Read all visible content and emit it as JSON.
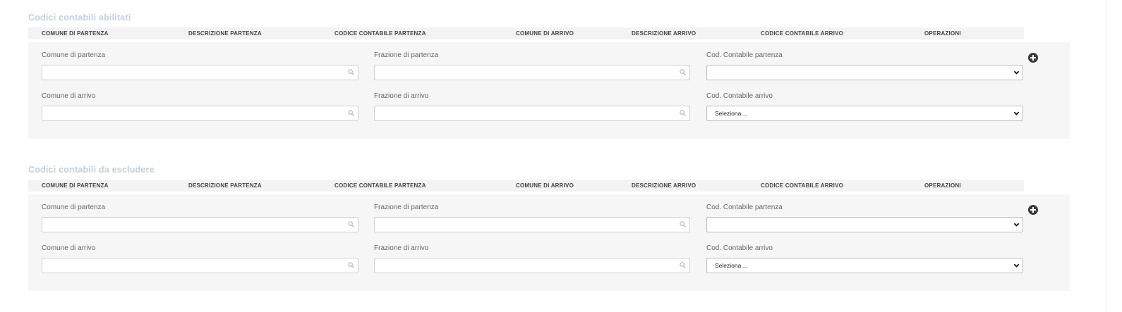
{
  "sections": [
    {
      "title": "Codici contabili abilitati",
      "columns": [
        "COMUNE DI PARTENZA",
        "DESCRIZIONE PARTENZA",
        "CODICE CONTABILE PARTENZA",
        "COMUNE DI ARRIVO",
        "DESCRIZIONE ARRIVO",
        "CODICE CONTABILE ARRIVO",
        "OPERAZIONI"
      ],
      "form": {
        "comune_partenza_label": "Comune di partenza",
        "comune_partenza_value": "",
        "frazione_partenza_label": "Frazione di partenza",
        "frazione_partenza_value": "",
        "cod_partenza_label": "Cod. Contabile partenza",
        "cod_partenza_selected": "",
        "comune_arrivo_label": "Comune di arrivo",
        "comune_arrivo_value": "",
        "frazione_arrivo_label": "Frazione di arrivo",
        "frazione_arrivo_value": "",
        "cod_arrivo_label": "Cod. Contabile arrivo",
        "cod_arrivo_selected": "Seleziona ..."
      }
    },
    {
      "title": "Codici contabili da escludere",
      "columns": [
        "COMUNE DI PARTENZA",
        "DESCRIZIONE PARTENZA",
        "CODICE CONTABILE PARTENZA",
        "COMUNE DI ARRIVO",
        "DESCRIZIONE ARRIVO",
        "CODICE CONTABILE ARRIVO",
        "OPERAZIONI"
      ],
      "form": {
        "comune_partenza_label": "Comune di partenza",
        "comune_partenza_value": "",
        "frazione_partenza_label": "Frazione di partenza",
        "frazione_partenza_value": "",
        "cod_partenza_label": "Cod. Contabile partenza",
        "cod_partenza_selected": "",
        "comune_arrivo_label": "Comune di arrivo",
        "comune_arrivo_value": "",
        "frazione_arrivo_label": "Frazione di arrivo",
        "frazione_arrivo_value": "",
        "cod_arrivo_label": "Cod. Contabile arrivo",
        "cod_arrivo_selected": "Seleziona ..."
      }
    }
  ],
  "icons": {
    "search": "search-icon",
    "add": "plus-circle-icon",
    "dropdown": "chevron-down-icon"
  },
  "colors": {
    "section_title": "#c3cfdc",
    "header_bg": "#f3f3f3",
    "panel_bg": "#f6f6f6",
    "add_button": "#3b3b3b"
  }
}
